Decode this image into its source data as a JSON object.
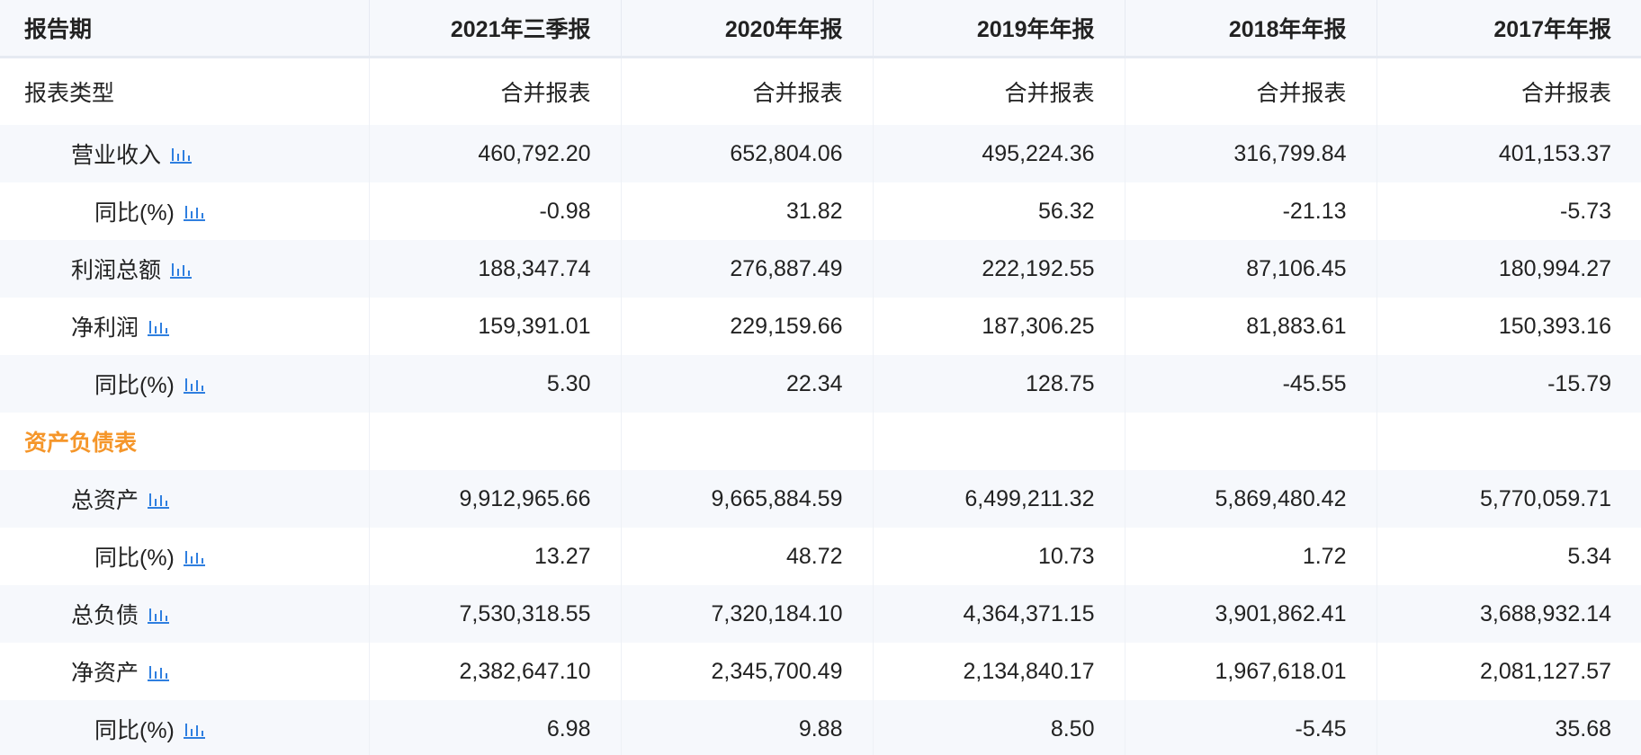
{
  "header": {
    "period_label": "报告期",
    "periods": [
      "2021年三季报",
      "2020年年报",
      "2019年年报",
      "2018年年报",
      "2017年年报"
    ]
  },
  "report_type": {
    "label": "报表类型",
    "values": [
      "合并报表",
      "合并报表",
      "合并报表",
      "合并报表",
      "合并报表"
    ]
  },
  "rows_income": [
    {
      "label": "营业收入",
      "icon": "bar-chart-icon",
      "values": [
        "460,792.20",
        "652,804.06",
        "495,224.36",
        "316,799.84",
        "401,153.37"
      ]
    },
    {
      "label": "同比(%)",
      "icon": "bar-chart-icon",
      "values": [
        "-0.98",
        "31.82",
        "56.32",
        "-21.13",
        "-5.73"
      ]
    },
    {
      "label": "利润总额",
      "icon": "bar-chart-icon",
      "values": [
        "188,347.74",
        "276,887.49",
        "222,192.55",
        "87,106.45",
        "180,994.27"
      ]
    },
    {
      "label": "净利润",
      "icon": "bar-chart-icon",
      "values": [
        "159,391.01",
        "229,159.66",
        "187,306.25",
        "81,883.61",
        "150,393.16"
      ]
    },
    {
      "label": "同比(%)",
      "icon": "bar-chart-icon",
      "values": [
        "5.30",
        "22.34",
        "128.75",
        "-45.55",
        "-15.79"
      ]
    }
  ],
  "balance_section": {
    "label": "资产负债表",
    "color": "#f5962a"
  },
  "rows_balance": [
    {
      "label": "总资产",
      "icon": "bar-chart-icon",
      "values": [
        "9,912,965.66",
        "9,665,884.59",
        "6,499,211.32",
        "5,869,480.42",
        "5,770,059.71"
      ]
    },
    {
      "label": "同比(%)",
      "icon": "bar-chart-icon",
      "values": [
        "13.27",
        "48.72",
        "10.73",
        "1.72",
        "5.34"
      ]
    },
    {
      "label": "总负债",
      "icon": "bar-chart-icon",
      "values": [
        "7,530,318.55",
        "7,320,184.10",
        "4,364,371.15",
        "3,901,862.41",
        "3,688,932.14"
      ]
    },
    {
      "label": "净资产",
      "icon": "bar-chart-icon",
      "values": [
        "2,382,647.10",
        "2,345,700.49",
        "2,134,840.17",
        "1,967,618.01",
        "2,081,127.57"
      ]
    },
    {
      "label": "同比(%)",
      "icon": "bar-chart-icon",
      "values": [
        "6.98",
        "9.88",
        "8.50",
        "-5.45",
        "35.68"
      ]
    }
  ],
  "colors": {
    "icon": "#2f7fe0",
    "header_bg": "#f6f8fc",
    "section": "#f5962a"
  }
}
